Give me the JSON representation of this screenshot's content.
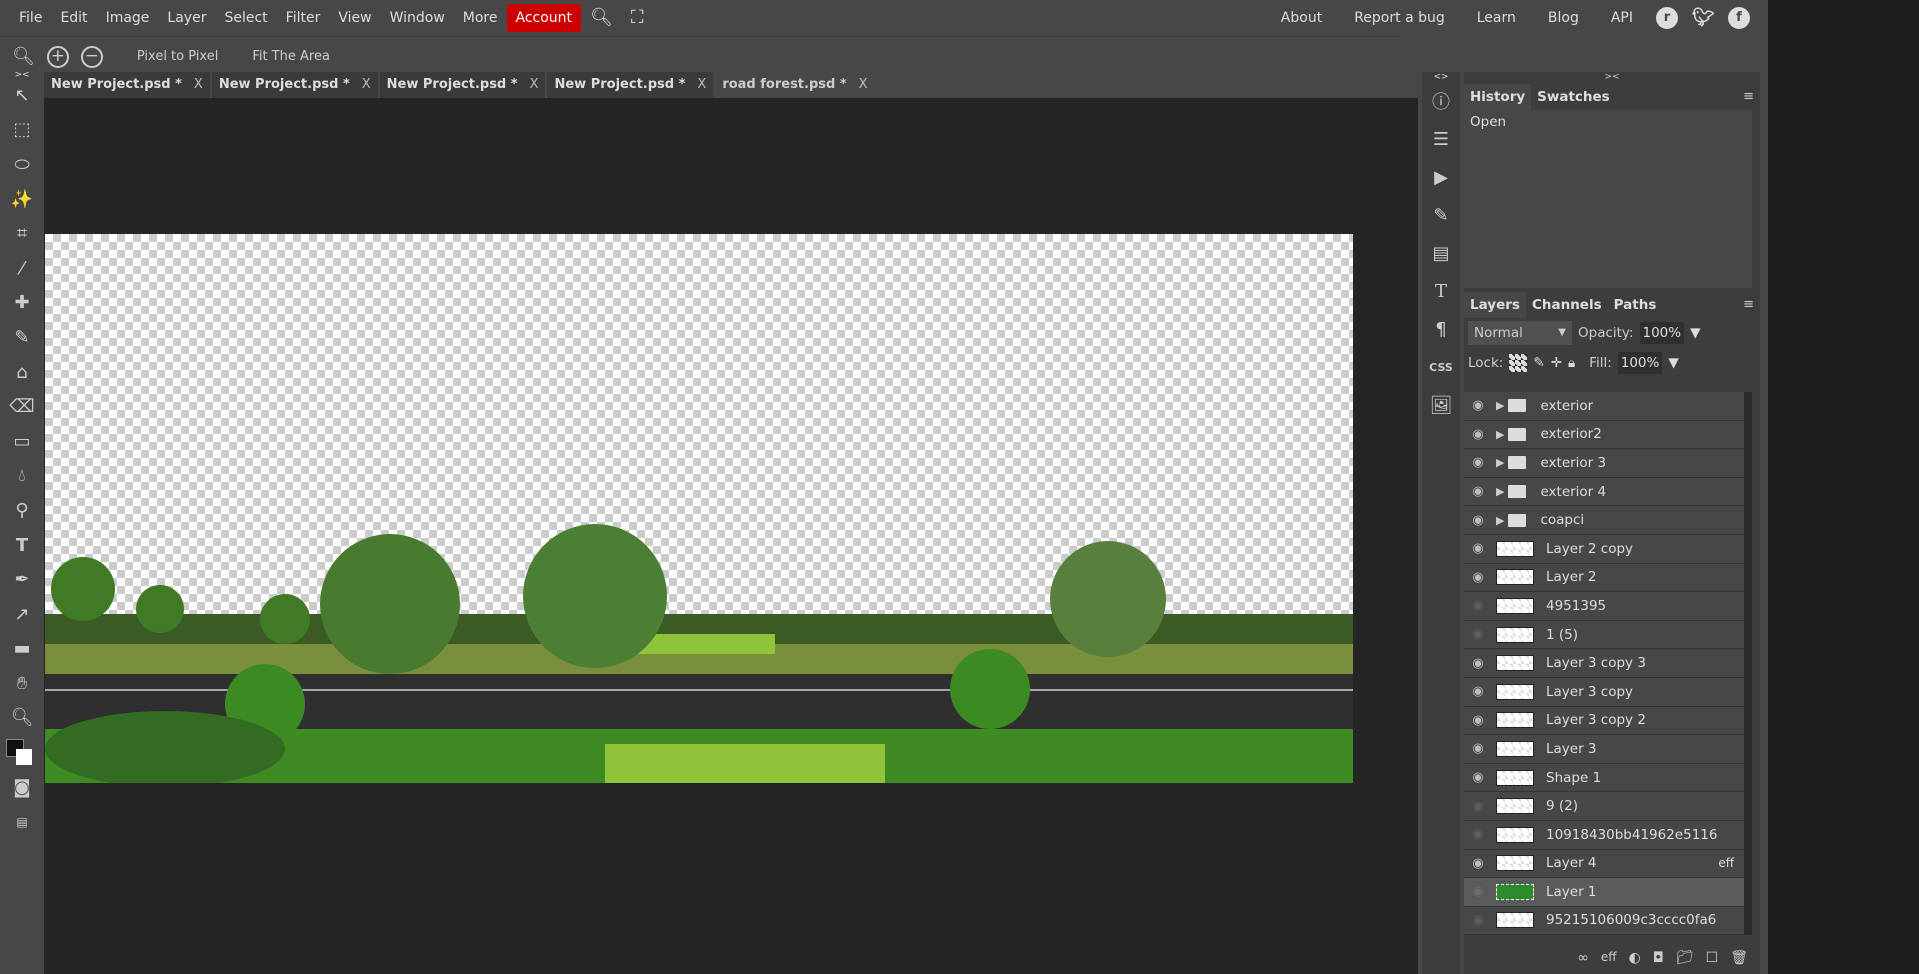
{
  "menu": [
    "File",
    "Edit",
    "Image",
    "Layer",
    "Select",
    "Filter",
    "View",
    "Window",
    "More"
  ],
  "account": "Account",
  "right_links": [
    "About",
    "Report a bug",
    "Learn",
    "Blog",
    "API"
  ],
  "social": [
    "reddit-icon",
    "twitter-icon",
    "facebook-icon"
  ],
  "options": {
    "pixel_to_pixel": "Pixel to Pixel",
    "fit_area": "Fit The Area"
  },
  "tabs": [
    {
      "label": "New Project.psd *"
    },
    {
      "label": "New Project.psd *"
    },
    {
      "label": "New Project.psd *"
    },
    {
      "label": "New Project.psd *"
    },
    {
      "label": "road forest.psd *",
      "active": true
    }
  ],
  "tab_close": "X",
  "history": {
    "tabs": [
      "History",
      "Swatches"
    ],
    "items": [
      "Open"
    ]
  },
  "layers_panel": {
    "tabs": [
      "Layers",
      "Channels",
      "Paths"
    ],
    "blend": "Normal",
    "opacity_label": "Opacity:",
    "opacity": "100%",
    "lock_label": "Lock:",
    "fill_label": "Fill:",
    "fill": "100%",
    "layers": [
      {
        "name": "exterior",
        "type": "folder",
        "visible": true
      },
      {
        "name": "exterior2",
        "type": "folder",
        "visible": true
      },
      {
        "name": "exterior 3",
        "type": "folder",
        "visible": true
      },
      {
        "name": "exterior 4",
        "type": "folder",
        "visible": true
      },
      {
        "name": "coapci",
        "type": "folder",
        "visible": true
      },
      {
        "name": "Layer 2 copy",
        "visible": true
      },
      {
        "name": "Layer 2",
        "visible": true
      },
      {
        "name": "4951395",
        "visible": false
      },
      {
        "name": "1 (5)",
        "visible": false
      },
      {
        "name": "Layer 3 copy 3",
        "visible": true
      },
      {
        "name": "Layer 3 copy",
        "visible": true
      },
      {
        "name": "Layer 3 copy 2",
        "visible": true
      },
      {
        "name": "Layer 3",
        "visible": true
      },
      {
        "name": "Shape 1",
        "visible": true
      },
      {
        "name": "9 (2)",
        "visible": false
      },
      {
        "name": "10918430bb41962e5116",
        "visible": false
      },
      {
        "name": "Layer 4",
        "visible": true,
        "effects": "eff"
      },
      {
        "name": "Layer 1",
        "visible": false,
        "selected": true
      },
      {
        "name": "95215106009c3cccc0fa6",
        "visible": false
      }
    ],
    "footer_eff": "eff"
  },
  "colors": {
    "accent": "#cc0000",
    "bg": "#474747",
    "canvas_bg": "#252525"
  },
  "toolbar_collapse": "><",
  "iconcol_collapse": "<>",
  "panel_collapse": "><"
}
